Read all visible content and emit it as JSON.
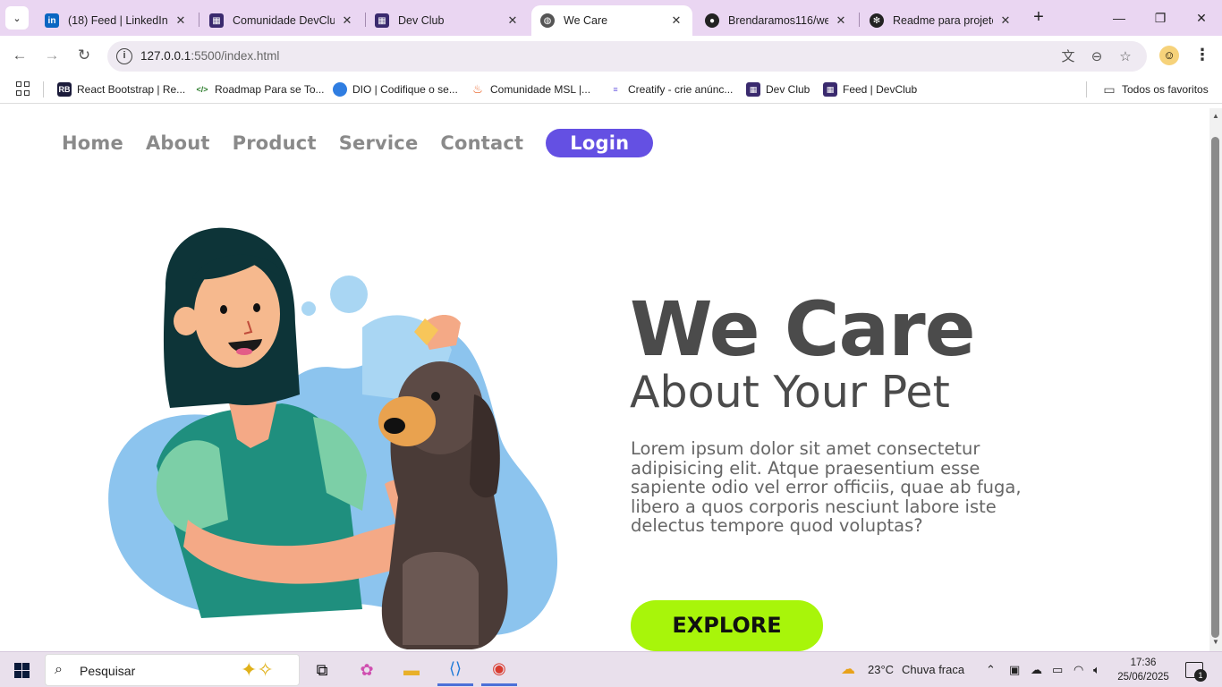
{
  "browser": {
    "tabs": [
      {
        "title": "(18) Feed | LinkedIn",
        "favicon": "linkedin-icon",
        "active": false
      },
      {
        "title": "Comunidade DevClub",
        "favicon": "devclub-icon",
        "active": false
      },
      {
        "title": "Dev Club",
        "favicon": "devclub-icon",
        "active": false
      },
      {
        "title": "We Care",
        "favicon": "globe-icon",
        "active": true
      },
      {
        "title": "Brendaramos116/we",
        "favicon": "github-icon",
        "active": false
      },
      {
        "title": "Readme para projeto",
        "favicon": "openai-icon",
        "active": false
      }
    ],
    "tab_close": "✕",
    "new_tab": "+",
    "address": {
      "host": "127.0.0.1",
      "rest": ":5500/index.html"
    },
    "bookmarks": [
      {
        "label": "React Bootstrap | Re...",
        "icon": "react-bootstrap-icon",
        "color": "#1b1b3a"
      },
      {
        "label": "Roadmap Para se To...",
        "icon": "code-icon",
        "color": "#2d7d2d"
      },
      {
        "label": "DIO | Codifique o se...",
        "icon": "dio-icon",
        "color": "#2f7de1"
      },
      {
        "label": "Comunidade MSL |...",
        "icon": "flame-icon",
        "color": "#e8591a"
      },
      {
        "label": "Creatify - crie anúnc...",
        "icon": "creatify-icon",
        "color": "#6b5be0"
      },
      {
        "label": "Dev Club",
        "icon": "devclub-icon",
        "color": "#3a2a6e"
      },
      {
        "label": "Feed | DevClub",
        "icon": "devclub-icon",
        "color": "#3a2a6e"
      }
    ],
    "all_bookmarks": "Todos os favoritos"
  },
  "page": {
    "nav": {
      "home": "Home",
      "about": "About",
      "product": "Product",
      "service": "Service",
      "contact": "Contact",
      "login": "Login"
    },
    "hero": {
      "title": "We Care",
      "subtitle": "About Your Pet",
      "description": "Lorem ipsum dolor sit amet consectetur adipisicing elit. Atque praesentium esse sapiente odio vel error officiis, quae ab fuga, libero a quos corporis nesciunt labore iste delectus tempore quod voluptas?",
      "cta": "EXPLORE"
    },
    "colors": {
      "accent": "#6450e3",
      "cta": "#a8f50a",
      "heading": "#4b4b4b"
    }
  },
  "taskbar": {
    "search_placeholder": "Pesquisar",
    "weather_temp": "23°C",
    "weather_desc": "Chuva fraca",
    "time": "17:36",
    "date": "25/06/2025",
    "notifications": "1"
  }
}
